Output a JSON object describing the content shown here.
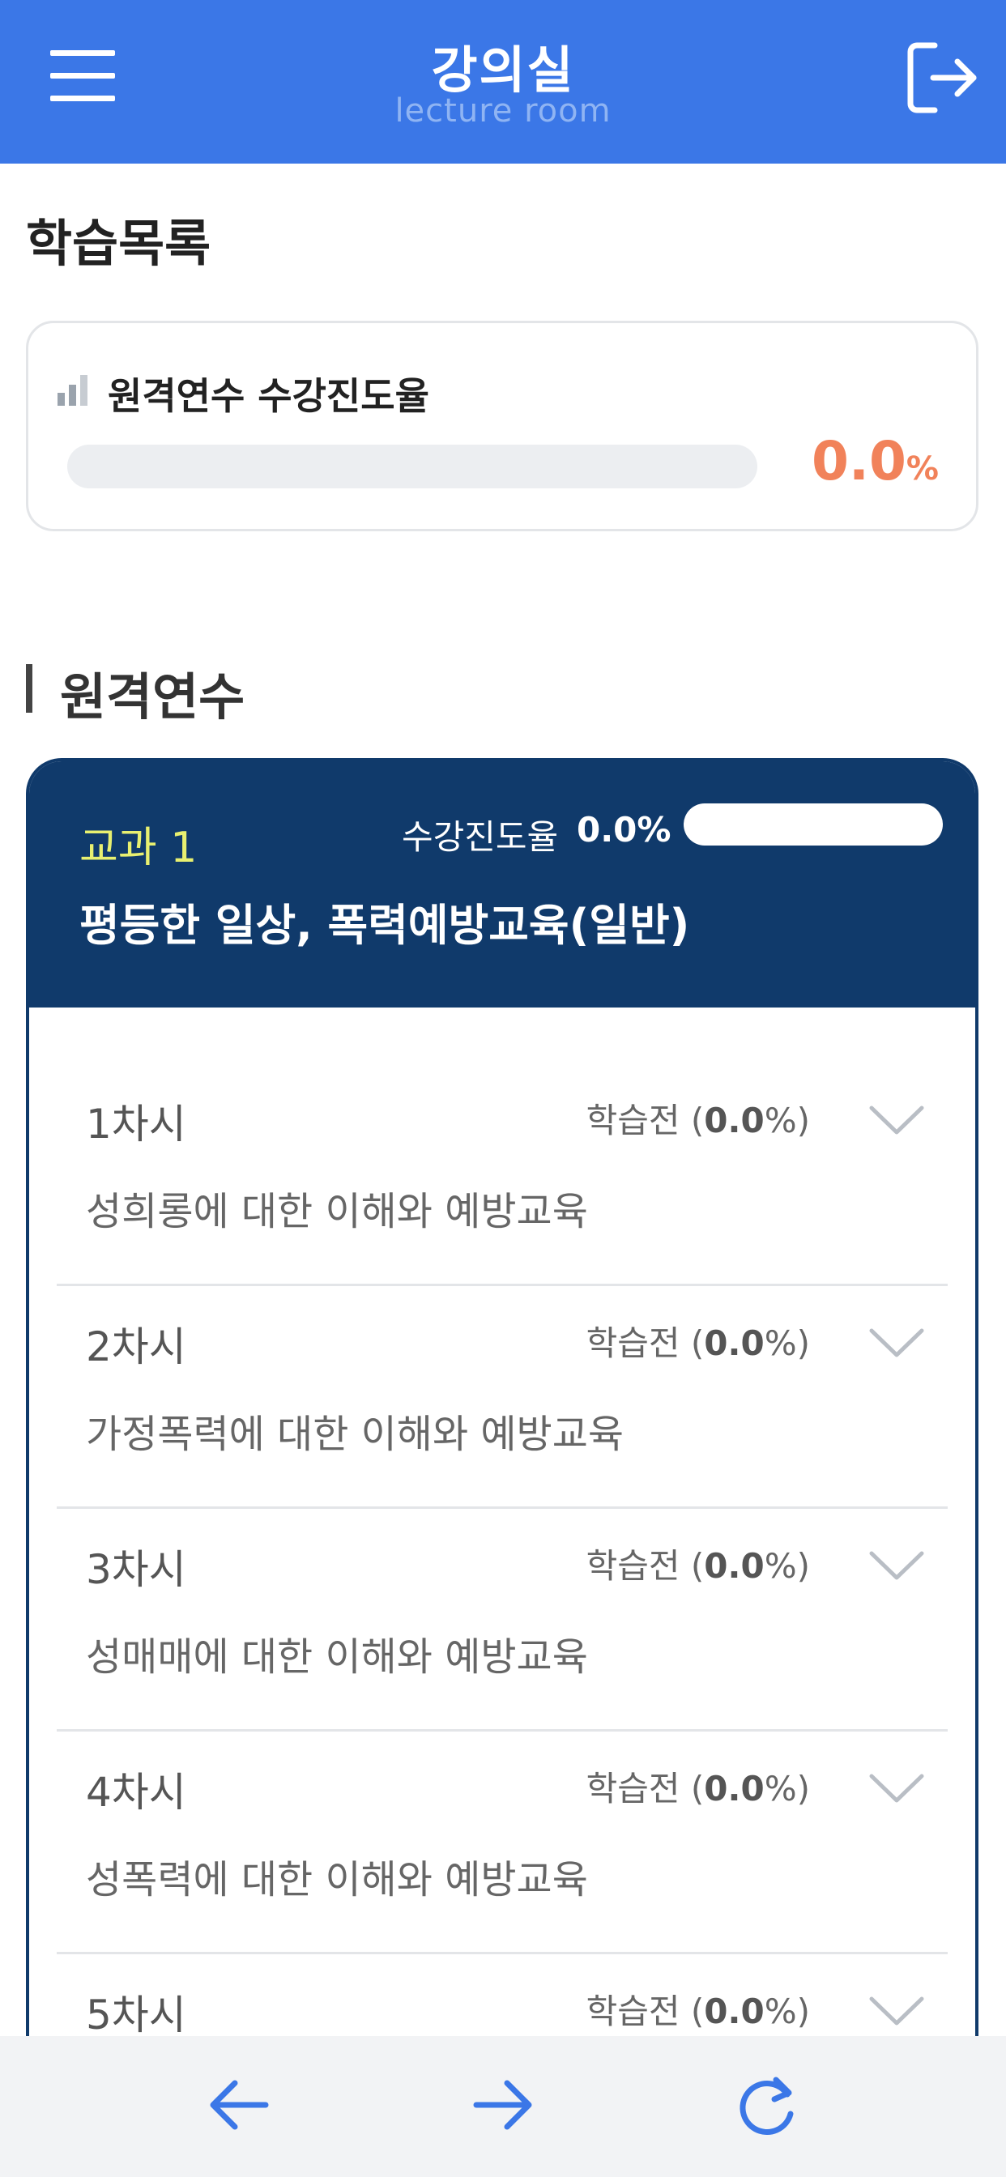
{
  "header": {
    "title": "강의실",
    "subtitle": "lecture room",
    "menu_icon": "hamburger-menu-icon",
    "logout_icon": "logout-icon",
    "bg_color": "#3b77e7"
  },
  "learning_list": {
    "title": "학습목록"
  },
  "overall_progress": {
    "label": "원격연수 수강진도율",
    "value": "0.0",
    "unit": "%",
    "fraction": 0.0,
    "icon": "signal-bars-icon",
    "accent_color": "#f1825a"
  },
  "section": {
    "title": "원격연수"
  },
  "course": {
    "number_label": "교과 1",
    "rate_label": "수강진도율",
    "rate_value": "0.0%",
    "rate_fraction": 0.0,
    "name": "평등한 일상, 폭력예방교육(일반)",
    "header_color": "#103a6b"
  },
  "lessons": [
    {
      "number": "1차시",
      "status_prefix": "학습전 (",
      "status_value": "0.0",
      "status_suffix": "%)",
      "title": "성희롱에 대한 이해와 예방교육"
    },
    {
      "number": "2차시",
      "status_prefix": "학습전 (",
      "status_value": "0.0",
      "status_suffix": "%)",
      "title": "가정폭력에 대한 이해와 예방교육"
    },
    {
      "number": "3차시",
      "status_prefix": "학습전 (",
      "status_value": "0.0",
      "status_suffix": "%)",
      "title": "성매매에 대한 이해와 예방교육"
    },
    {
      "number": "4차시",
      "status_prefix": "학습전 (",
      "status_value": "0.0",
      "status_suffix": "%)",
      "title": "성폭력에 대한 이해와 예방교육"
    },
    {
      "number": "5차시",
      "status_prefix": "학습전 (",
      "status_value": "0.0",
      "status_suffix": "%)",
      "title": ""
    }
  ],
  "bottom_nav": {
    "back_icon": "arrow-left-icon",
    "forward_icon": "arrow-right-icon",
    "reload_icon": "reload-icon",
    "icon_color": "#3b77e7"
  }
}
